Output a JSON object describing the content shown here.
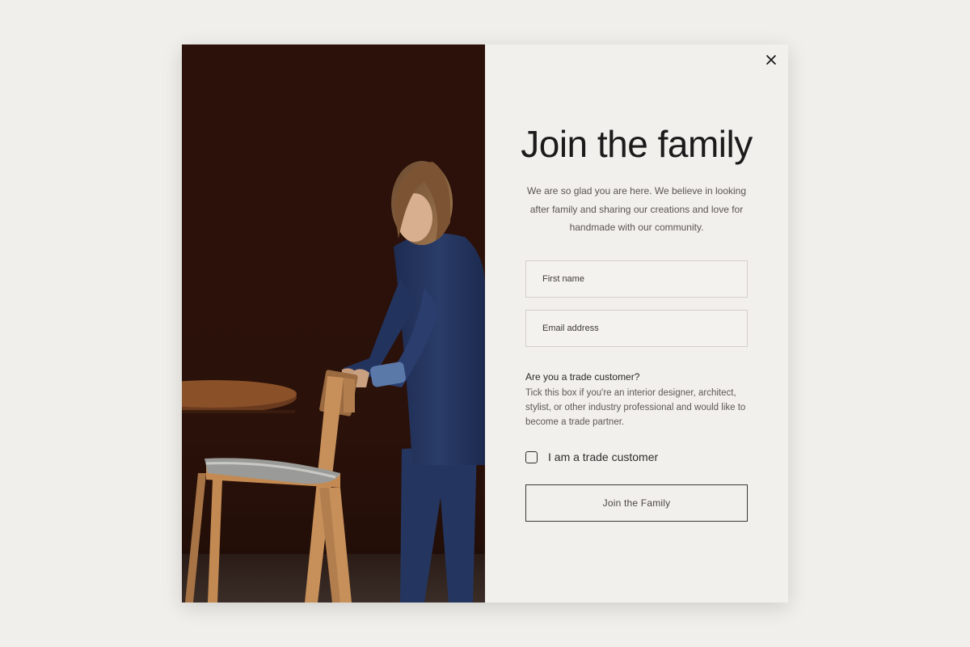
{
  "modal": {
    "close_icon": "close-icon",
    "title": "Join the family",
    "intro": "We are so glad you are here. We believe in looking after family and sharing our creations and love for handmade with our community.",
    "form": {
      "first_name_placeholder": "First name",
      "email_placeholder": "Email address",
      "trade_question": "Are you a trade customer?",
      "trade_description": "Tick this box if you're an interior designer, architect, stylist, or other industry professional and would like to become a trade partner.",
      "trade_checkbox_label": "I am a trade customer",
      "trade_checkbox_checked": false,
      "submit_label": "Join the Family"
    }
  },
  "colors": {
    "page_background": "#f1efeb",
    "modal_background": "#f2f0ec",
    "photo_background": "#2a110b",
    "text_dark": "#1b1b1b"
  }
}
